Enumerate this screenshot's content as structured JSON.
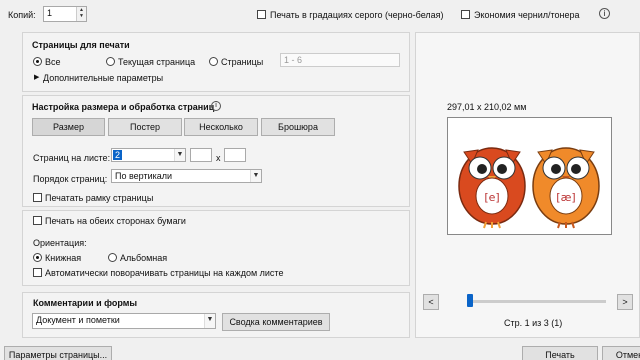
{
  "top": {
    "copies_label": "Копий:",
    "copies_value": "1",
    "grayscale_label": "Печать в градациях серого (черно-белая)",
    "save_ink_label": "Экономия чернил/тонера",
    "help_icon": "help-icon"
  },
  "pages": {
    "title": "Страницы для печати",
    "all": "Все",
    "current": "Текущая страница",
    "pages": "Страницы",
    "range_placeholder": "1 - 6",
    "more_options": "Дополнительные параметры"
  },
  "sizing": {
    "title": "Настройка размера и обработка страниц",
    "info_icon": "info-icon",
    "buttons": [
      "Размер",
      "Постер",
      "Несколько",
      "Брошюра"
    ],
    "pages_per_sheet_label": "Страниц на листе:",
    "pages_per_sheet_value": "2",
    "by": "x",
    "order_label": "Порядок страниц:",
    "order_value": "По вертикали",
    "print_border": "Печатать рамку страницы"
  },
  "duplex": {
    "both_sides": "Печать на обеих сторонах бумаги"
  },
  "orientation": {
    "label": "Ориентация:",
    "portrait": "Книжная",
    "landscape": "Альбомная",
    "auto_rotate": "Автоматически поворачивать страницы на каждом листе"
  },
  "comments": {
    "title": "Комментарии и формы",
    "value": "Документ и пометки",
    "summarize": "Сводка комментариев"
  },
  "preview": {
    "size": "297,01 x 210,02 мм",
    "page_status": "Стр. 1 из 3 (1)",
    "prev": "<",
    "next": ">",
    "owl_labels": [
      "[e]",
      "[æ]"
    ],
    "slider_fraction": 0.0
  },
  "footer": {
    "page_setup": "Параметры страницы...",
    "print": "Печать",
    "cancel": "Отмена"
  },
  "colors": {
    "owl_left": "#d94a1f",
    "owl_right": "#f08a2a",
    "selected": "#0a64c8"
  }
}
